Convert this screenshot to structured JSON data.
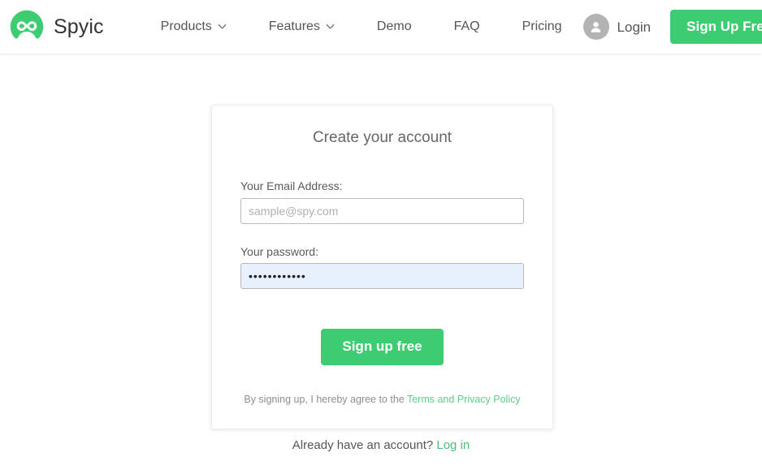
{
  "header": {
    "brand": {
      "name": "Spyic",
      "logo_icon": "infinity-logo-icon",
      "logo_color": "#3ecc72"
    },
    "nav": [
      {
        "label": "Products",
        "has_dropdown": true,
        "icon": "chevron-down-icon"
      },
      {
        "label": "Features",
        "has_dropdown": true,
        "icon": "chevron-down-icon"
      },
      {
        "label": "Demo",
        "has_dropdown": false,
        "icon": ""
      },
      {
        "label": "FAQ",
        "has_dropdown": false,
        "icon": ""
      },
      {
        "label": "Pricing",
        "has_dropdown": false,
        "icon": ""
      }
    ],
    "login": {
      "label": "Login",
      "icon": "user-avatar-icon"
    },
    "signup_button": {
      "label": "Sign Up Free",
      "color": "#3ecc72"
    }
  },
  "signup_card": {
    "title": "Create your account",
    "email": {
      "label": "Your Email Address:",
      "placeholder": "sample@spy.com",
      "value": ""
    },
    "password": {
      "label": "Your password:",
      "placeholder": "",
      "value": "••••••••••••",
      "autofilled": true,
      "autofill_color": "#e8f0fd"
    },
    "submit_button": {
      "label": "Sign up free",
      "color": "#3ecc72"
    },
    "terms": {
      "text": "By signing up, I hereby agree to the",
      "link_label": "Terms and Privacy Policy"
    }
  },
  "footer": {
    "prompt": "Already have an account?",
    "link_label": "Log in"
  }
}
